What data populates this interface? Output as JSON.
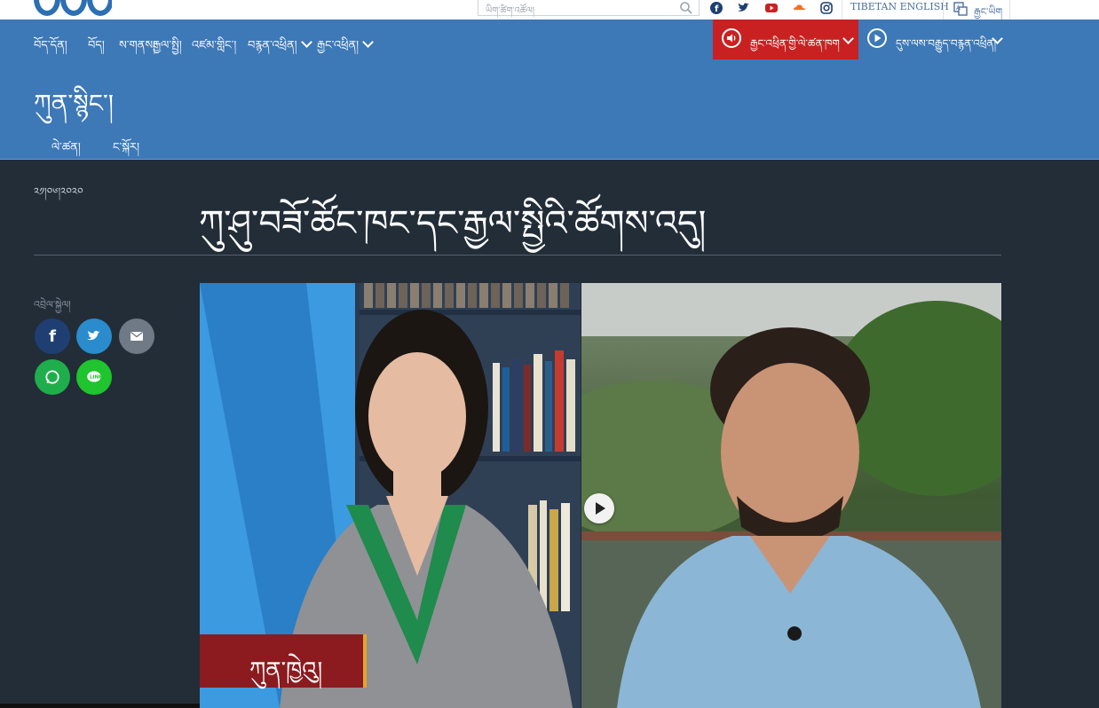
{
  "topbar": {
    "search_placeholder": "ཡིག་ཚིག་འཚོལ།",
    "language_links": [
      "TIBETAN ENGLISH",
      "རྒྱང་ཡིག"
    ],
    "social_icons": [
      "facebook-icon",
      "twitter-icon",
      "youtube-icon",
      "soundcloud-icon",
      "instagram-icon"
    ]
  },
  "nav": {
    "items": [
      "བོད་དོན།",
      "བོད།",
      "ས་གནས།",
      "རྒྱལ་སྤྱི།",
      "འཛམ་གླིང་།",
      "བརྙན་འཕྲིན།",
      "རྒྱང་འཕྲིན།"
    ],
    "live_audio": "རྒྱང་འཕྲིན་གྱི་ལེ་ཚན་ཁག",
    "live_video": "དུས་ལས་བརྒྱུད་བརྙན་འཕྲིན།"
  },
  "section": {
    "title": "ཀུན་སྙིང་།",
    "sub_items": [
      "ལེ་ཚན།",
      "ང་སྐོར།"
    ]
  },
  "article": {
    "date": "༢༡།༠༦།༢༠༢༠",
    "headline": "ཀུ་ཤུ་བཟོ་ཚོང་ཁང་དང་རྒྱལ་སྤྱིའི་ཚོགས་འདུ།",
    "share_label": "འབྲེལ་སྐྱེལ།",
    "share_buttons": [
      "facebook",
      "twitter",
      "email",
      "whatsapp",
      "line"
    ]
  },
  "video": {
    "name_tag": "ཀུན་ཁྱེའུ།"
  },
  "colors": {
    "nav_blue": "#3d78b7",
    "live_red": "#c92121",
    "page_dark": "#222d38",
    "facebook": "#1f3f73",
    "twitter": "#2a8ccc",
    "email": "#6f7a86",
    "whatsapp": "#1fae4b",
    "line": "#1fc42e"
  }
}
